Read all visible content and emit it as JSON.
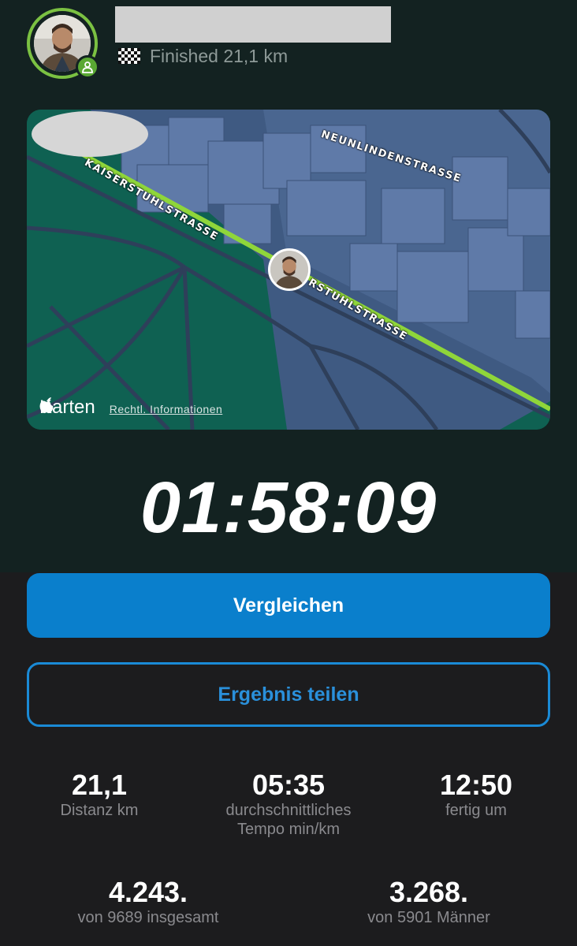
{
  "header": {
    "status_text": "Finished 21,1 km",
    "flag_icon": "checkered-flag-icon",
    "badge_icon": "user-icon",
    "accent_color": "#7bc142"
  },
  "map": {
    "streets": [
      "NEUNLINDENSTRASSE",
      "KAISERSTUHLSTRASSE",
      "RSTUHLSTRASSE"
    ],
    "brand": "Karten",
    "legal_link": "Rechtl. Informationen"
  },
  "timer": "01:58:09",
  "buttons": {
    "compare": "Vergleichen",
    "share": "Ergebnis teilen"
  },
  "stats": [
    {
      "value": "21,1",
      "label": "Distanz km"
    },
    {
      "value": "05:35",
      "label": "durchschnittliches Tempo min/km"
    },
    {
      "value": "12:50",
      "label": "fertig um"
    }
  ],
  "ranks": [
    {
      "value": "4.243.",
      "label": "von 9689 insgesamt"
    },
    {
      "value": "3.268.",
      "label": "von 5901 Männer"
    }
  ],
  "colors": {
    "primary_button": "#0a7fcc",
    "outline_button": "#1a8ad6",
    "top_background": "#132221",
    "bottom_background": "#1c1c1e"
  }
}
